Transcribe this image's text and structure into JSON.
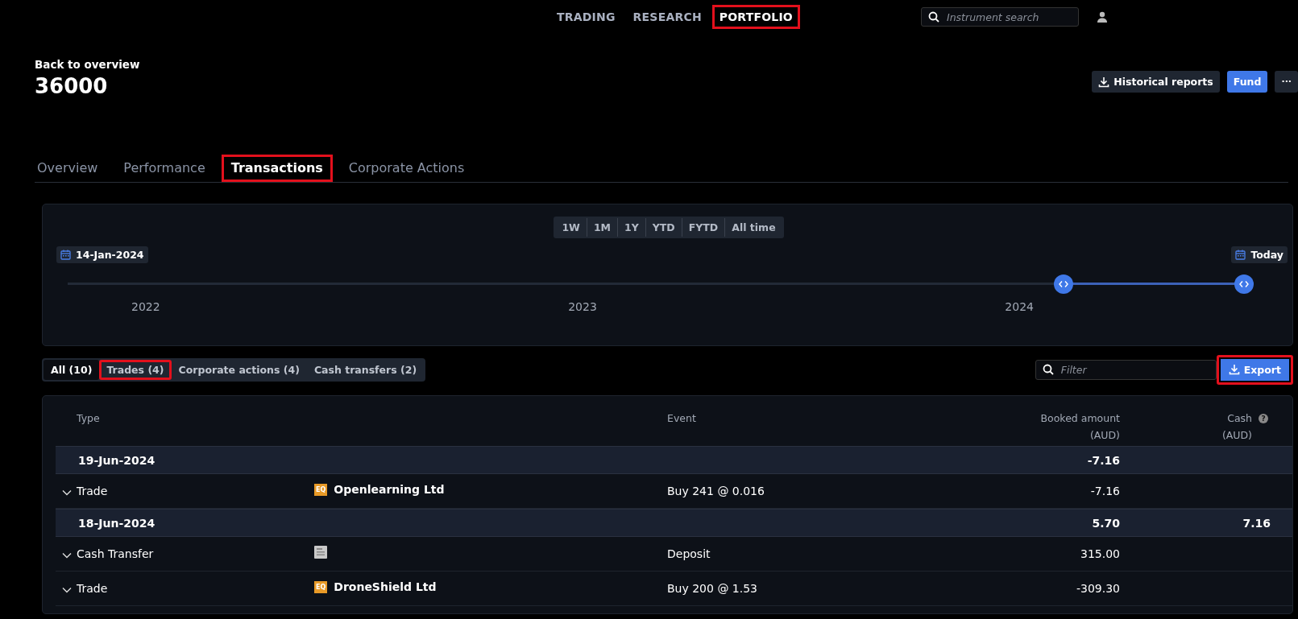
{
  "nav": {
    "items": [
      {
        "label": "TRADING",
        "selected": false,
        "highlighted": false
      },
      {
        "label": "RESEARCH",
        "selected": false,
        "highlighted": false
      },
      {
        "label": "PORTFOLIO",
        "selected": true,
        "highlighted": true
      }
    ],
    "search": {
      "placeholder": "Instrument search"
    }
  },
  "header": {
    "back_link": "Back to overview",
    "account": "36000",
    "buttons": [
      {
        "label": "Historical reports",
        "kind": "download"
      },
      {
        "label": "Fund",
        "kind": "primary"
      },
      {
        "label": "···",
        "kind": "more"
      }
    ]
  },
  "tabs": [
    {
      "label": "Overview",
      "selected": false,
      "highlighted": false
    },
    {
      "label": "Performance",
      "selected": false,
      "highlighted": false
    },
    {
      "label": "Transactions",
      "selected": true,
      "highlighted": true
    },
    {
      "label": "Corporate Actions",
      "selected": false,
      "highlighted": false
    }
  ],
  "timeline": {
    "ranges": [
      "1W",
      "1M",
      "1Y",
      "YTD",
      "FYTD",
      "All time"
    ],
    "start_date": "14-Jan-2024",
    "end_date": "Today",
    "level": 0.16,
    "years": [
      "2022",
      "2023",
      "2024"
    ]
  },
  "filters": [
    {
      "label": "All (10)",
      "selected": true,
      "highlighted": false
    },
    {
      "label": "Trades (4)",
      "selected": false,
      "highlighted": true
    },
    {
      "label": "Corporate actions (4)",
      "selected": false,
      "highlighted": false
    },
    {
      "label": "Cash transfers (2)",
      "selected": false,
      "highlighted": false
    }
  ],
  "filter_field": {
    "placeholder": "Filter"
  },
  "export": {
    "label": "Export",
    "highlighted": true
  },
  "table": {
    "columns": [
      {
        "label": "Type"
      },
      {
        "label": "Event"
      },
      {
        "label": "Booked amount",
        "sub": "(AUD)"
      },
      {
        "label": "Cash",
        "sub": "(AUD)",
        "help": "?"
      }
    ],
    "groups": [
      {
        "date": "19-Jun-2024",
        "booked": "-7.16",
        "rows": [
          {
            "type": "Trade",
            "kind": "equity",
            "badge": "EQ",
            "instrument": "Openlearning Ltd",
            "event": "Buy 241 @ 0.016",
            "booked": "-7.16"
          }
        ]
      },
      {
        "date": "18-Jun-2024",
        "booked": "5.70",
        "cash": "7.16",
        "rows": [
          {
            "type": "Cash Transfer",
            "kind": "cash",
            "event": "Deposit",
            "booked": "315.00"
          },
          {
            "type": "Trade",
            "kind": "equity",
            "badge": "EQ",
            "instrument": "DroneShield Ltd",
            "event": "Buy 200 @ 1.53",
            "booked": "-309.30"
          }
        ]
      }
    ]
  }
}
